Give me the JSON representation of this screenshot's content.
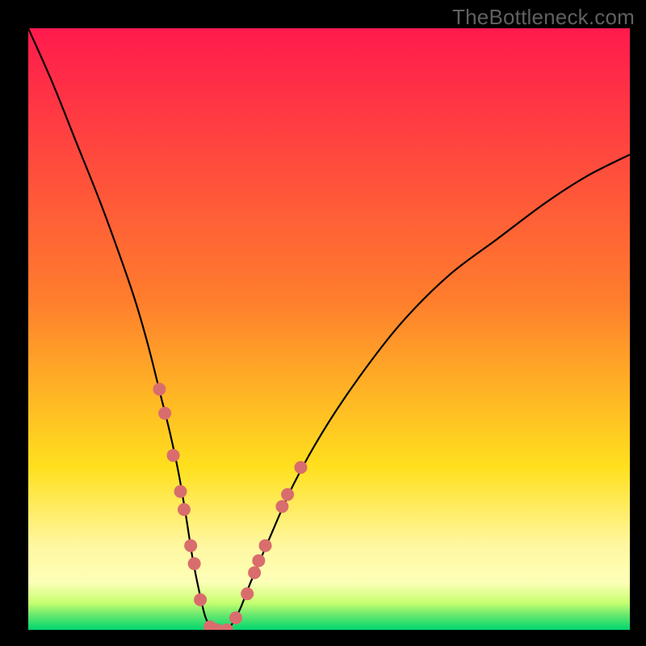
{
  "watermark": "TheBottleneck.com",
  "chart_data": {
    "type": "line",
    "title": "",
    "xlabel": "",
    "ylabel": "",
    "xlim": [
      0,
      100
    ],
    "ylim": [
      0,
      100
    ],
    "grid": false,
    "legend": false,
    "background_gradient": {
      "stops": [
        {
          "offset": "0%",
          "color": "#ff1a4d"
        },
        {
          "offset": "45%",
          "color": "#ff7d2d"
        },
        {
          "offset": "73%",
          "color": "#ffe01e"
        },
        {
          "offset": "86%",
          "color": "#fff7a0"
        },
        {
          "offset": "92%",
          "color": "#fdffb7"
        },
        {
          "offset": "95.5%",
          "color": "#c7ff70"
        },
        {
          "offset": "97.5%",
          "color": "#69e86e"
        },
        {
          "offset": "100%",
          "color": "#00d66f"
        }
      ]
    },
    "series": [
      {
        "name": "bottleneck-curve",
        "color": "#000000",
        "x": [
          0,
          4,
          8,
          12,
          16,
          18,
          20,
          22,
          23.5,
          25,
          26.2,
          27.3,
          28.5,
          29.5,
          30.8,
          33,
          35,
          37,
          40,
          44,
          49,
          55,
          62,
          70,
          78,
          86,
          93,
          100
        ],
        "y": [
          100,
          91,
          81,
          71,
          60,
          54,
          47,
          39,
          33,
          26,
          19,
          12,
          6,
          2,
          0,
          0,
          3,
          8,
          15,
          24,
          33,
          42,
          51,
          59,
          65,
          71,
          75.5,
          79
        ]
      }
    ],
    "markers": {
      "color": "#d96d6d",
      "radius": 8,
      "points": [
        {
          "x": 21.8,
          "y": 40
        },
        {
          "x": 22.7,
          "y": 36
        },
        {
          "x": 24.1,
          "y": 29
        },
        {
          "x": 25.3,
          "y": 23
        },
        {
          "x": 25.9,
          "y": 20
        },
        {
          "x": 27.0,
          "y": 14
        },
        {
          "x": 27.6,
          "y": 11
        },
        {
          "x": 28.6,
          "y": 5
        },
        {
          "x": 30.2,
          "y": 0.5
        },
        {
          "x": 31.4,
          "y": 0
        },
        {
          "x": 33.0,
          "y": 0
        },
        {
          "x": 34.5,
          "y": 2
        },
        {
          "x": 36.4,
          "y": 6
        },
        {
          "x": 37.6,
          "y": 9.5
        },
        {
          "x": 38.3,
          "y": 11.5
        },
        {
          "x": 39.4,
          "y": 14
        },
        {
          "x": 42.2,
          "y": 20.5
        },
        {
          "x": 43.1,
          "y": 22.5
        },
        {
          "x": 45.3,
          "y": 27
        }
      ]
    }
  }
}
